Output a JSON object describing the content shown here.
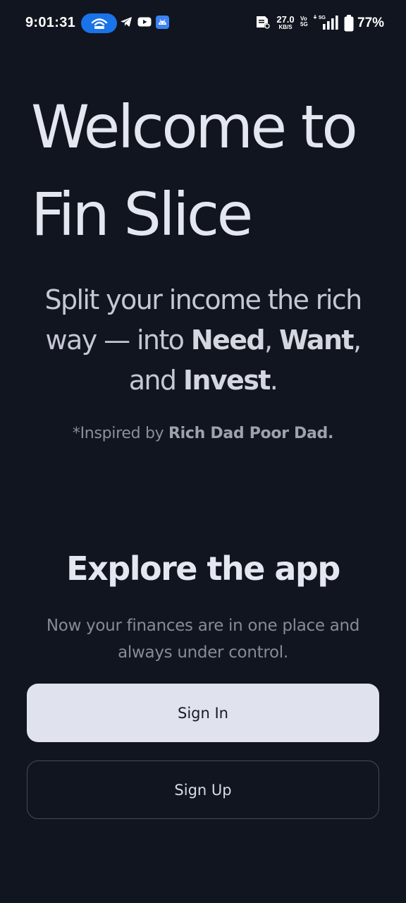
{
  "status_bar": {
    "time": "9:01:31",
    "net_speed_value": "27.0",
    "net_speed_unit": "KB/S",
    "volte_top": "Vo",
    "volte_bottom": "5G",
    "network_type": "5G",
    "battery_percent": "77%",
    "icons": [
      "hotspot-icon",
      "telegram-icon",
      "youtube-icon",
      "android-icon",
      "sim-card-icon",
      "signal-icon",
      "battery-icon"
    ]
  },
  "hero": {
    "title_line1": "Welcome to",
    "title_line2": "Fin Slice",
    "subtitle_pre": "Split your income the rich way — into ",
    "subtitle_need": "Need",
    "subtitle_sep1": ", ",
    "subtitle_want": "Want",
    "subtitle_sep2": ", and ",
    "subtitle_invest": "Invest",
    "subtitle_end": ".",
    "inspired_pre": "*Inspired by ",
    "inspired_book": "Rich Dad Poor Dad."
  },
  "explore": {
    "title": "Explore the app",
    "description": "Now your finances are in one place and always under control."
  },
  "buttons": {
    "sign_in": "Sign In",
    "sign_up": "Sign Up"
  },
  "colors": {
    "background": "#11151f",
    "title_text": "#e4e6f0",
    "primary_button_bg": "#e0e2ee",
    "primary_button_text": "#181b24",
    "secondary_button_border": "#474b57",
    "hotspot_pill": "#1a73e8"
  }
}
